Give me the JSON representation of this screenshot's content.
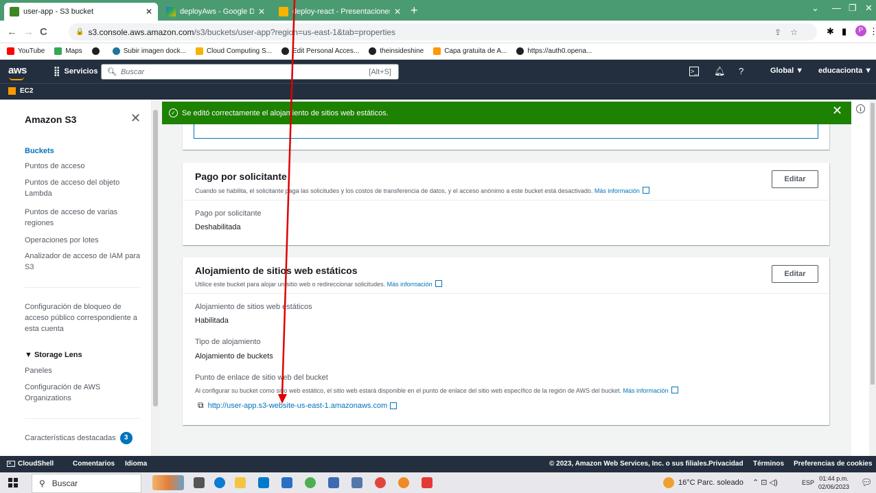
{
  "browser": {
    "tabs": [
      {
        "title": "user-app - S3 bucket",
        "color": "#3f8624",
        "active": true
      },
      {
        "title": "deployAws - Google Drive",
        "color": "#1a73e8",
        "active": false
      },
      {
        "title": "deploy-react - Presentaciones de",
        "color": "#f4b400",
        "active": false
      }
    ],
    "new_tab": "+",
    "url_host": "s3.console.aws.amazon.com",
    "url_path": "/s3/buckets/user-app?region=us-east-1&tab=properties",
    "profile_initial": "P",
    "bookmarks": [
      {
        "label": "YouTube",
        "color": "#ff0000"
      },
      {
        "label": "Maps",
        "color": "#34a853"
      },
      {
        "label": "",
        "color": "#202124"
      },
      {
        "label": "Subir imagen dock...",
        "color": "#21759b"
      },
      {
        "label": "Cloud Computing S...",
        "color": "#f4b400"
      },
      {
        "label": "Edit Personal Acces...",
        "color": "#202124"
      },
      {
        "label": "theinsideshine",
        "color": "#202124"
      },
      {
        "label": "Capa gratuita de A...",
        "color": "#ff9900"
      },
      {
        "label": "https://auth0.opena...",
        "color": "#202124"
      }
    ]
  },
  "aws_header": {
    "logo": "aws",
    "services": "Servicios",
    "search_placeholder": "Buscar",
    "search_shortcut": "[Alt+S]",
    "region": "Global ▼",
    "account": "educacionta ▼",
    "favorite": "EC2"
  },
  "sidebar": {
    "title": "Amazon S3",
    "items": [
      {
        "label": "Buckets",
        "active": true
      },
      {
        "label": "Puntos de acceso"
      },
      {
        "label": "Puntos de acceso del objeto Lambda"
      },
      {
        "label": "Puntos de acceso de varias regiones"
      },
      {
        "label": "Operaciones por lotes"
      },
      {
        "label": "Analizador de acceso de IAM para S3"
      }
    ],
    "block_access": "Configuración de bloqueo de acceso público correspondiente a esta cuenta",
    "storage_lens": "▼ Storage Lens",
    "storage_items": [
      "Paneles",
      "Configuración de AWS Organizations"
    ],
    "featured": "Características destacadas",
    "featured_count": "3"
  },
  "flash": {
    "message": "Se editó correctamente el alojamiento de sitios web estáticos.",
    "color": "#1d8102"
  },
  "requester_pays": {
    "title": "Pago por solicitante",
    "description": "Cuando se habilita, el solicitante paga las solicitudes y los costos de transferencia de datos, y el acceso anónimo a este bucket está desactivado.",
    "more_info": "Más información",
    "edit": "Editar",
    "field_label": "Pago por solicitante",
    "field_value": "Deshabilitada"
  },
  "static_hosting": {
    "title": "Alojamiento de sitios web estáticos",
    "description": "Utilice este bucket para alojar un sitio web o redireccionar solicitudes.",
    "more_info": "Más información",
    "edit": "Editar",
    "hosting_label": "Alojamiento de sitios web estáticos",
    "hosting_value": "Habilitada",
    "type_label": "Tipo de alojamiento",
    "type_value": "Alojamiento de buckets",
    "endpoint_label": "Punto de enlace de sitio web del bucket",
    "endpoint_desc": "Al configurar su bucket como sitio web estático, el sitio web estará disponible en el punto de enlace del sitio web específico de la región de AWS del bucket.",
    "endpoint_more": "Más información",
    "endpoint_url": "http://user-app.s3-website-us-east-1.amazonaws.com"
  },
  "footer": {
    "cloudshell": "CloudShell",
    "comments": "Comentarios",
    "language": "Idioma",
    "copyright": "© 2023, Amazon Web Services, Inc. o sus filiales.",
    "privacy": "Privacidad",
    "terms": "Términos",
    "cookies": "Preferencias de cookies"
  },
  "taskbar": {
    "search": "Buscar",
    "weather": "16°C  Parc. soleado",
    "lang": "ESP",
    "time": "01:44 p.m.",
    "date": "02/06/2023"
  }
}
